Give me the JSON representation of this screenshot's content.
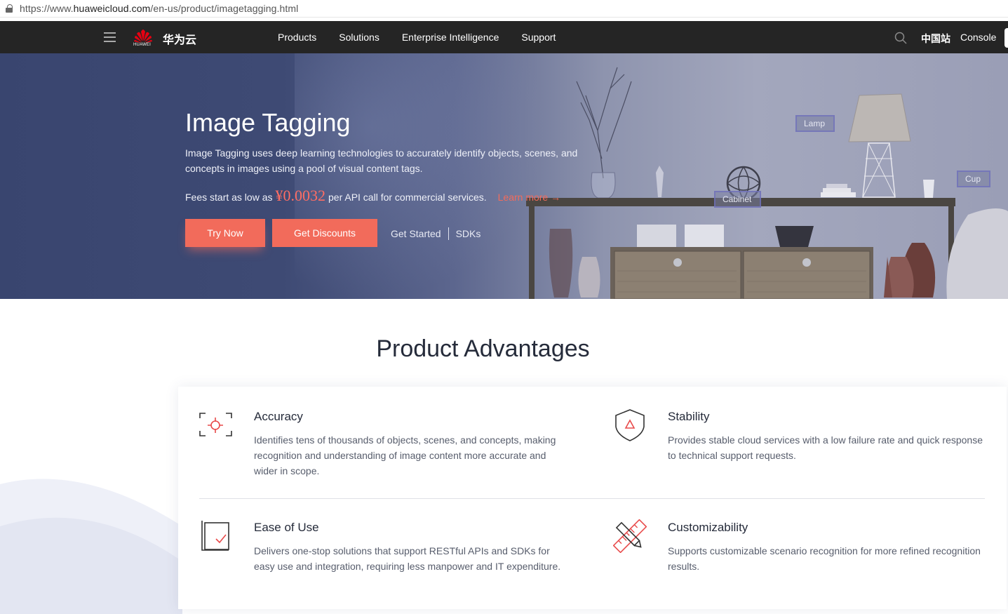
{
  "browser": {
    "url_prefix": "https://www.",
    "url_host": "huaweicloud.com",
    "url_path": "/en-us/product/imagetagging.html"
  },
  "nav": {
    "logo_text": "HUAWEI",
    "brand": "华为云",
    "links": [
      "Products",
      "Solutions",
      "Enterprise Intelligence",
      "Support"
    ],
    "lang": "中国站",
    "console": "Console",
    "icons": [
      "menu-icon",
      "huawei-logo",
      "search-icon"
    ]
  },
  "hero": {
    "title": "Image Tagging",
    "description": "Image Tagging uses deep learning technologies to accurately identify objects, scenes, and concepts in images using a pool of visual content tags.",
    "fees_prefix": "Fees start as low as",
    "price": "¥0.0032",
    "fees_suffix": "per API call for commercial services.",
    "learn_more": "Learn more →",
    "try_now": "Try Now",
    "get_discounts": "Get Discounts",
    "get_started": "Get Started",
    "sdks": "SDKs",
    "tags": {
      "lamp": "Lamp",
      "cup": "Cup",
      "cabinet": "Cabinet"
    }
  },
  "advantages": {
    "title": "Product Advantages",
    "items": [
      {
        "title": "Accuracy",
        "text": "Identifies tens of thousands of objects, scenes, and concepts, making recognition and understanding of image content more accurate and wider in scope.",
        "icon": "target-icon"
      },
      {
        "title": "Stability",
        "text": "Provides stable cloud services with a low failure rate and quick response to technical support requests.",
        "icon": "shield-icon"
      },
      {
        "title": "Ease of Use",
        "text": "Delivers one-stop solutions that support RESTful APIs and SDKs for easy use and integration, requiring less manpower and IT expenditure.",
        "icon": "document-check-icon"
      },
      {
        "title": "Customizability",
        "text": "Supports customizable scenario recognition for more refined recognition results.",
        "icon": "ruler-pencil-icon"
      }
    ]
  },
  "colors": {
    "accent": "#f26b5b",
    "nav_bg": "#252525",
    "hero_bg": "#3e4a74"
  }
}
